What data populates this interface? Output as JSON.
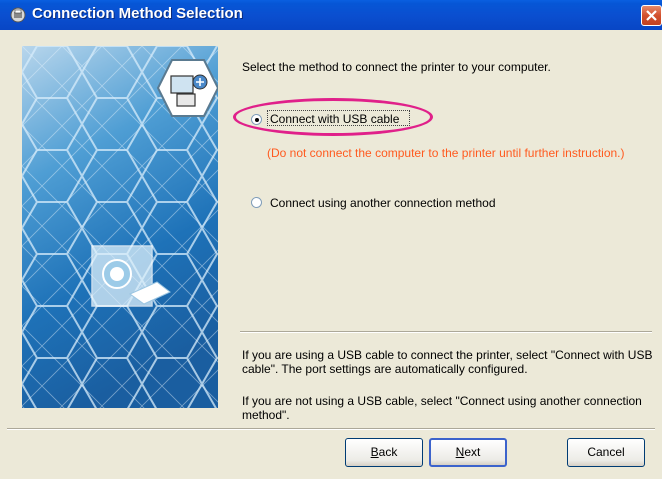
{
  "window": {
    "title": "Connection Method Selection",
    "close_icon": "close-icon"
  },
  "content": {
    "instruction": "Select the method to connect the printer to your computer.",
    "options": [
      {
        "label": "Connect with USB cable",
        "selected": true,
        "highlighted": true
      },
      {
        "label": "Connect using another connection method",
        "selected": false
      }
    ],
    "warning": "(Do not connect the computer to the printer until further instruction.)",
    "info_usb": "If you are using a USB cable to connect the printer, select \"Connect with USB cable\". The port settings are automatically configured.",
    "info_other": "If you are not using a USB cable, select \"Connect using another connection method\"."
  },
  "buttons": {
    "back_key": "B",
    "back_rest": "ack",
    "next_key": "N",
    "next_rest": "ext",
    "cancel": "Cancel"
  },
  "colors": {
    "title_bar": "#0a4fd0",
    "warning_text": "#ff5a1f",
    "highlight_ring": "#e0208a",
    "panel_blue": "#2f87c9"
  }
}
